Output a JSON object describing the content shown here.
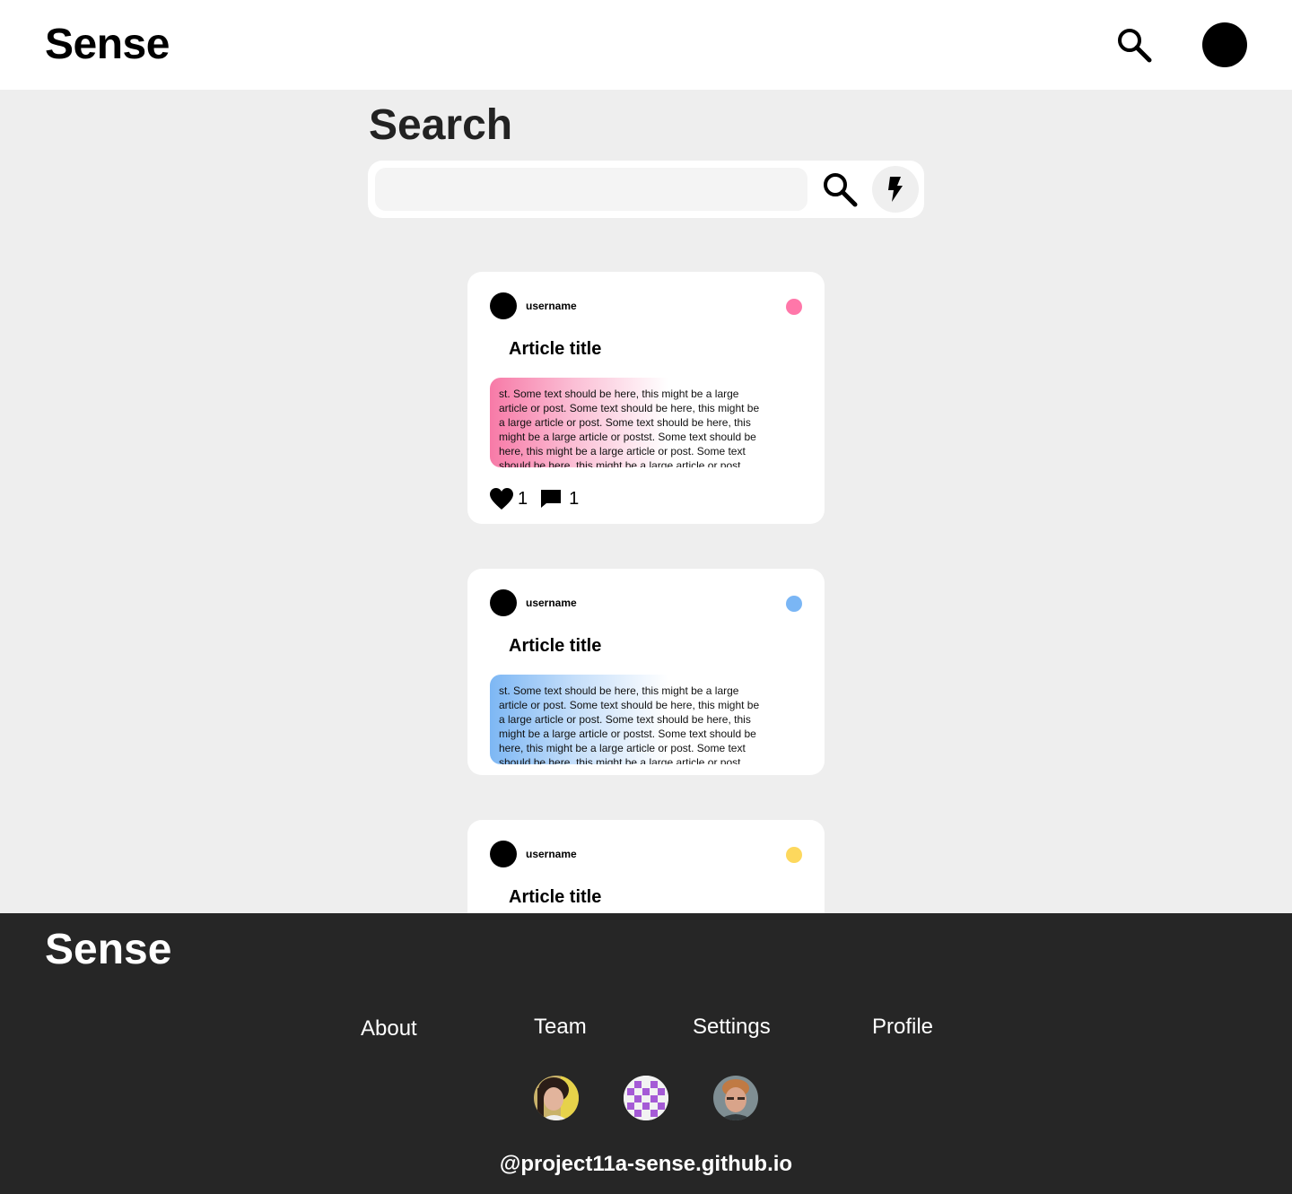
{
  "header": {
    "logo": "Sense",
    "search_icon": "search-icon",
    "profile_avatar": "avatar"
  },
  "page": {
    "title": "Search"
  },
  "search": {
    "value": "",
    "placeholder": "",
    "search_icon": "search-icon",
    "flash_icon": "lightning-bolt-icon"
  },
  "posts": [
    {
      "username": "username",
      "title": "Article title",
      "dot_color": "#ff77a9",
      "text": "st. Some text should be here, this might be a large article or post. Some text should be here, this might be a large article or post. Some text should be here, this might be a large article or postst. Some text should be here, this might be a large article or post. Some text should be here, this might be a large article or post. Some text",
      "likes": "1",
      "comments": "1"
    },
    {
      "username": "username",
      "title": "Article title",
      "dot_color": "#7ab6f5",
      "text": "st. Some text should be here, this might be a large article or post. Some text should be here, this might be a large article or post. Some text should be here, this might be a large article or postst. Some text should be here, this might be a large article or post. Some text should be here, this might be a large article or post. Some text"
    },
    {
      "username": "username",
      "title": "Article title",
      "dot_color": "#fdd85d"
    }
  ],
  "footer": {
    "logo": "Sense",
    "links": [
      "About",
      "Team",
      "Settings",
      "Profile"
    ],
    "handle": "@project11a-sense.github.io"
  },
  "colors": {
    "background": "#eeeeee",
    "footer": "#262626",
    "pink": "#ff77a9",
    "blue": "#7ab6f5",
    "yellow": "#fdd85d"
  }
}
